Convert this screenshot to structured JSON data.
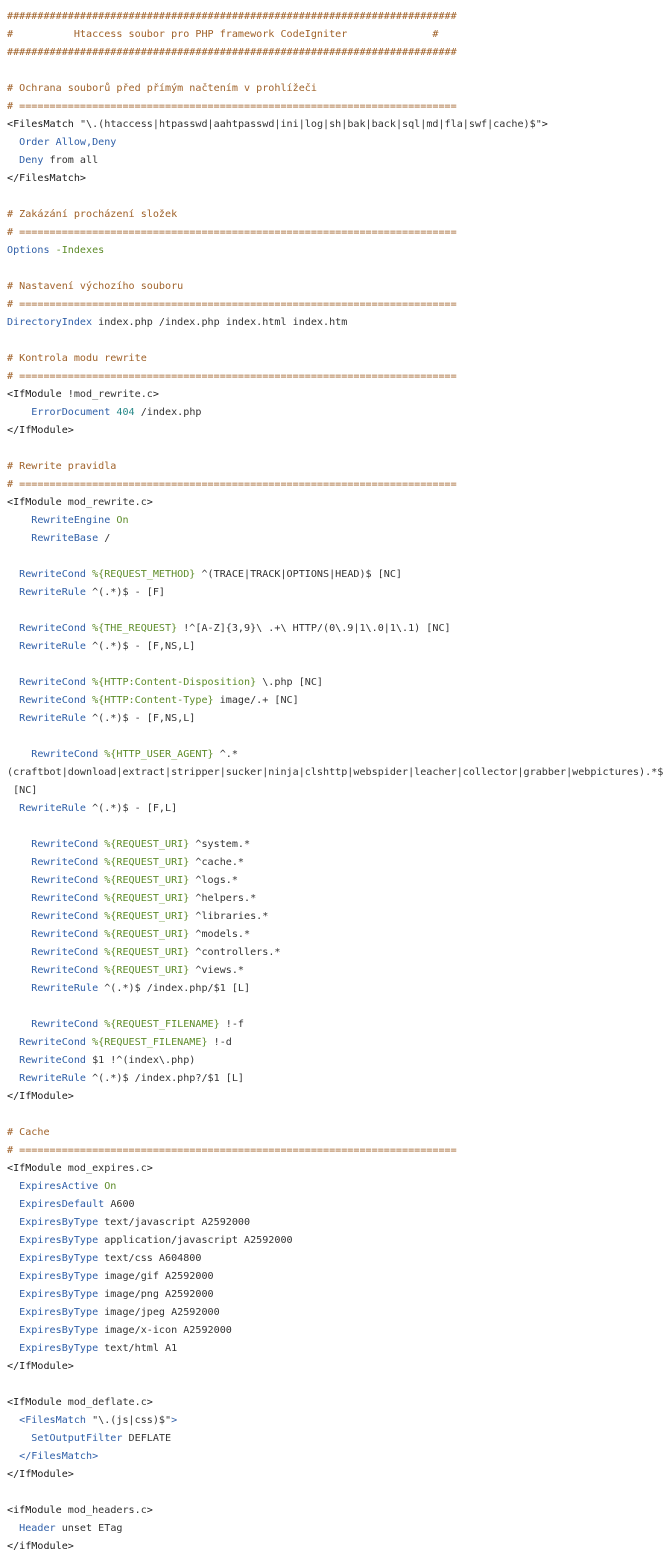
{
  "document": {
    "lines": [
      {
        "segments": [
          {
            "t": "##########################################################################",
            "c": "cm"
          }
        ]
      },
      {
        "segments": [
          {
            "t": "#          Htaccess soubor pro PHP framework CodeIgniter              #",
            "c": "cm"
          }
        ]
      },
      {
        "segments": [
          {
            "t": "##########################################################################",
            "c": "cm"
          }
        ]
      },
      {
        "segments": []
      },
      {
        "segments": [
          {
            "t": "# Ochrana souborů před přímým načtením v prohlížeči",
            "c": "cm"
          }
        ]
      },
      {
        "segments": [
          {
            "t": "# ========================================================================",
            "c": "cm"
          }
        ]
      },
      {
        "segments": [
          {
            "t": "<FilesMatch ",
            "c": "tg"
          },
          {
            "t": "\"\\.(htaccess|htpasswd|aahtpasswd|ini|log|sh|bak|back|sql|md|fla|swf|cache)$\"",
            "c": "st"
          },
          {
            "t": ">",
            "c": "tg"
          }
        ]
      },
      {
        "segments": [
          {
            "t": "  Order Allow,Deny",
            "c": "kw"
          }
        ]
      },
      {
        "segments": [
          {
            "t": "  Deny ",
            "c": "kw"
          },
          {
            "t": "from all",
            "c": "st"
          }
        ]
      },
      {
        "segments": [
          {
            "t": "</FilesMatch>",
            "c": "tg"
          }
        ]
      },
      {
        "segments": []
      },
      {
        "segments": [
          {
            "t": "# Zakázání procházení složek",
            "c": "cm"
          }
        ]
      },
      {
        "segments": [
          {
            "t": "# ========================================================================",
            "c": "cm"
          }
        ]
      },
      {
        "segments": [
          {
            "t": "Options ",
            "c": "kw"
          },
          {
            "t": "-Indexes",
            "c": "fl"
          }
        ]
      },
      {
        "segments": []
      },
      {
        "segments": [
          {
            "t": "# Nastavení výchozího souboru",
            "c": "cm"
          }
        ]
      },
      {
        "segments": [
          {
            "t": "# ========================================================================",
            "c": "cm"
          }
        ]
      },
      {
        "segments": [
          {
            "t": "DirectoryIndex ",
            "c": "kw"
          },
          {
            "t": "index.php /index.php index.html index.htm",
            "c": "st"
          }
        ]
      },
      {
        "segments": []
      },
      {
        "segments": [
          {
            "t": "# Kontrola modu rewrite",
            "c": "cm"
          }
        ]
      },
      {
        "segments": [
          {
            "t": "# ========================================================================",
            "c": "cm"
          }
        ]
      },
      {
        "segments": [
          {
            "t": "<IfModule ",
            "c": "tg"
          },
          {
            "t": "!mod_rewrite.c",
            "c": "st"
          },
          {
            "t": ">",
            "c": "tg"
          }
        ]
      },
      {
        "segments": [
          {
            "t": "    ErrorDocument ",
            "c": "kw"
          },
          {
            "t": "404",
            "c": "nm"
          },
          {
            "t": " /index.php",
            "c": "st"
          }
        ]
      },
      {
        "segments": [
          {
            "t": "</IfModule>",
            "c": "tg"
          }
        ]
      },
      {
        "segments": []
      },
      {
        "segments": [
          {
            "t": "# Rewrite pravidla",
            "c": "cm"
          }
        ]
      },
      {
        "segments": [
          {
            "t": "# ========================================================================",
            "c": "cm"
          }
        ]
      },
      {
        "segments": [
          {
            "t": "<IfModule ",
            "c": "tg"
          },
          {
            "t": "mod_rewrite.c",
            "c": "st"
          },
          {
            "t": ">",
            "c": "tg"
          }
        ]
      },
      {
        "segments": [
          {
            "t": "    RewriteEngine ",
            "c": "kw"
          },
          {
            "t": "On",
            "c": "fl"
          }
        ]
      },
      {
        "segments": [
          {
            "t": "    RewriteBase ",
            "c": "kw"
          },
          {
            "t": "/",
            "c": "st"
          }
        ]
      },
      {
        "segments": []
      },
      {
        "segments": [
          {
            "t": "  RewriteCond ",
            "c": "kw"
          },
          {
            "t": "%{REQUEST_METHOD}",
            "c": "fl"
          },
          {
            "t": " ^(TRACE|TRACK|OPTIONS|HEAD)$ [NC]",
            "c": "st"
          }
        ]
      },
      {
        "segments": [
          {
            "t": "  RewriteRule ",
            "c": "kw"
          },
          {
            "t": "^(.*)$ - [F]",
            "c": "st"
          }
        ]
      },
      {
        "segments": []
      },
      {
        "segments": [
          {
            "t": "  RewriteCond ",
            "c": "kw"
          },
          {
            "t": "%{THE_REQUEST}",
            "c": "fl"
          },
          {
            "t": " !^[A-Z]{3,9}\\ .+\\ HTTP/(0\\.9|1\\.0|1\\.1) [NC]",
            "c": "st"
          }
        ]
      },
      {
        "segments": [
          {
            "t": "  RewriteRule ",
            "c": "kw"
          },
          {
            "t": "^(.*)$ - [F,NS,L]",
            "c": "st"
          }
        ]
      },
      {
        "segments": []
      },
      {
        "segments": [
          {
            "t": "  RewriteCond ",
            "c": "kw"
          },
          {
            "t": "%{HTTP:Content-Disposition}",
            "c": "fl"
          },
          {
            "t": " \\.php [NC]",
            "c": "st"
          }
        ]
      },
      {
        "segments": [
          {
            "t": "  RewriteCond ",
            "c": "kw"
          },
          {
            "t": "%{HTTP:Content-Type}",
            "c": "fl"
          },
          {
            "t": " image/.+ [NC]",
            "c": "st"
          }
        ]
      },
      {
        "segments": [
          {
            "t": "  RewriteRule ",
            "c": "kw"
          },
          {
            "t": "^(.*)$ - [F,NS,L]",
            "c": "st"
          }
        ]
      },
      {
        "segments": []
      },
      {
        "segments": [
          {
            "t": "    RewriteCond ",
            "c": "kw"
          },
          {
            "t": "%{HTTP_USER_AGENT}",
            "c": "fl"
          },
          {
            "t": " ^.*",
            "c": "st"
          }
        ]
      },
      {
        "segments": [
          {
            "t": "(craftbot|download|extract|stripper|sucker|ninja|clshttp|webspider|leacher|collector|grabber|webpictures).*$",
            "c": "st"
          }
        ]
      },
      {
        "segments": [
          {
            "t": " [NC]",
            "c": "st"
          }
        ]
      },
      {
        "segments": [
          {
            "t": "  RewriteRule ",
            "c": "kw"
          },
          {
            "t": "^(.*)$ - [F,L]",
            "c": "st"
          }
        ]
      },
      {
        "segments": []
      },
      {
        "segments": [
          {
            "t": "    RewriteCond ",
            "c": "kw"
          },
          {
            "t": "%{REQUEST_URI}",
            "c": "fl"
          },
          {
            "t": " ^system.*",
            "c": "st"
          }
        ]
      },
      {
        "segments": [
          {
            "t": "    RewriteCond ",
            "c": "kw"
          },
          {
            "t": "%{REQUEST_URI}",
            "c": "fl"
          },
          {
            "t": " ^cache.*",
            "c": "st"
          }
        ]
      },
      {
        "segments": [
          {
            "t": "    RewriteCond ",
            "c": "kw"
          },
          {
            "t": "%{REQUEST_URI}",
            "c": "fl"
          },
          {
            "t": " ^logs.*",
            "c": "st"
          }
        ]
      },
      {
        "segments": [
          {
            "t": "    RewriteCond ",
            "c": "kw"
          },
          {
            "t": "%{REQUEST_URI}",
            "c": "fl"
          },
          {
            "t": " ^helpers.*",
            "c": "st"
          }
        ]
      },
      {
        "segments": [
          {
            "t": "    RewriteCond ",
            "c": "kw"
          },
          {
            "t": "%{REQUEST_URI}",
            "c": "fl"
          },
          {
            "t": " ^libraries.*",
            "c": "st"
          }
        ]
      },
      {
        "segments": [
          {
            "t": "    RewriteCond ",
            "c": "kw"
          },
          {
            "t": "%{REQUEST_URI}",
            "c": "fl"
          },
          {
            "t": " ^models.*",
            "c": "st"
          }
        ]
      },
      {
        "segments": [
          {
            "t": "    RewriteCond ",
            "c": "kw"
          },
          {
            "t": "%{REQUEST_URI}",
            "c": "fl"
          },
          {
            "t": " ^controllers.*",
            "c": "st"
          }
        ]
      },
      {
        "segments": [
          {
            "t": "    RewriteCond ",
            "c": "kw"
          },
          {
            "t": "%{REQUEST_URI}",
            "c": "fl"
          },
          {
            "t": " ^views.*",
            "c": "st"
          }
        ]
      },
      {
        "segments": [
          {
            "t": "    RewriteRule ",
            "c": "kw"
          },
          {
            "t": "^(.*)$ /index.php/$1 [L]",
            "c": "st"
          }
        ]
      },
      {
        "segments": []
      },
      {
        "segments": [
          {
            "t": "    RewriteCond ",
            "c": "kw"
          },
          {
            "t": "%{REQUEST_FILENAME}",
            "c": "fl"
          },
          {
            "t": " !-f",
            "c": "st"
          }
        ]
      },
      {
        "segments": [
          {
            "t": "  RewriteCond ",
            "c": "kw"
          },
          {
            "t": "%{REQUEST_FILENAME}",
            "c": "fl"
          },
          {
            "t": " !-d",
            "c": "st"
          }
        ]
      },
      {
        "segments": [
          {
            "t": "  RewriteCond ",
            "c": "kw"
          },
          {
            "t": "$1 !^(index\\.php)",
            "c": "st"
          }
        ]
      },
      {
        "segments": [
          {
            "t": "  RewriteRule ",
            "c": "kw"
          },
          {
            "t": "^(.*)$ /index.php?/$1 [L]",
            "c": "st"
          }
        ]
      },
      {
        "segments": [
          {
            "t": "</IfModule>",
            "c": "tg"
          }
        ]
      },
      {
        "segments": []
      },
      {
        "segments": [
          {
            "t": "# Cache",
            "c": "cm"
          }
        ]
      },
      {
        "segments": [
          {
            "t": "# ========================================================================",
            "c": "cm"
          }
        ]
      },
      {
        "segments": [
          {
            "t": "<IfModule ",
            "c": "tg"
          },
          {
            "t": "mod_expires.c",
            "c": "st"
          },
          {
            "t": ">",
            "c": "tg"
          }
        ]
      },
      {
        "segments": [
          {
            "t": "  ExpiresActive ",
            "c": "kw"
          },
          {
            "t": "On",
            "c": "fl"
          }
        ]
      },
      {
        "segments": [
          {
            "t": "  ExpiresDefault ",
            "c": "kw"
          },
          {
            "t": "A600",
            "c": "st"
          }
        ]
      },
      {
        "segments": [
          {
            "t": "  ExpiresByType ",
            "c": "kw"
          },
          {
            "t": "text/javascript A2592000",
            "c": "st"
          }
        ]
      },
      {
        "segments": [
          {
            "t": "  ExpiresByType ",
            "c": "kw"
          },
          {
            "t": "application/javascript A2592000",
            "c": "st"
          }
        ]
      },
      {
        "segments": [
          {
            "t": "  ExpiresByType ",
            "c": "kw"
          },
          {
            "t": "text/css A604800",
            "c": "st"
          }
        ]
      },
      {
        "segments": [
          {
            "t": "  ExpiresByType ",
            "c": "kw"
          },
          {
            "t": "image/gif A2592000",
            "c": "st"
          }
        ]
      },
      {
        "segments": [
          {
            "t": "  ExpiresByType ",
            "c": "kw"
          },
          {
            "t": "image/png A2592000",
            "c": "st"
          }
        ]
      },
      {
        "segments": [
          {
            "t": "  ExpiresByType ",
            "c": "kw"
          },
          {
            "t": "image/jpeg A2592000",
            "c": "st"
          }
        ]
      },
      {
        "segments": [
          {
            "t": "  ExpiresByType ",
            "c": "kw"
          },
          {
            "t": "image/x-icon A2592000",
            "c": "st"
          }
        ]
      },
      {
        "segments": [
          {
            "t": "  ExpiresByType ",
            "c": "kw"
          },
          {
            "t": "text/html A1",
            "c": "st"
          }
        ]
      },
      {
        "segments": [
          {
            "t": "</IfModule>",
            "c": "tg"
          }
        ]
      },
      {
        "segments": []
      },
      {
        "segments": [
          {
            "t": "<IfModule ",
            "c": "tg"
          },
          {
            "t": "mod_deflate.c",
            "c": "st"
          },
          {
            "t": ">",
            "c": "tg"
          }
        ]
      },
      {
        "segments": [
          {
            "t": "  <FilesMatch ",
            "c": "kw"
          },
          {
            "t": "\"\\.(js|css)$\"",
            "c": "st"
          },
          {
            "t": ">",
            "c": "kw"
          }
        ]
      },
      {
        "segments": [
          {
            "t": "    SetOutputFilter ",
            "c": "kw"
          },
          {
            "t": "DEFLATE",
            "c": "st"
          }
        ]
      },
      {
        "segments": [
          {
            "t": "  </FilesMatch>",
            "c": "kw"
          }
        ]
      },
      {
        "segments": [
          {
            "t": "</IfModule>",
            "c": "tg"
          }
        ]
      },
      {
        "segments": []
      },
      {
        "segments": [
          {
            "t": "<ifModule ",
            "c": "tg"
          },
          {
            "t": "mod_headers.c",
            "c": "st"
          },
          {
            "t": ">",
            "c": "tg"
          }
        ]
      },
      {
        "segments": [
          {
            "t": "  Header ",
            "c": "kw"
          },
          {
            "t": "unset ETag",
            "c": "st"
          }
        ]
      },
      {
        "segments": [
          {
            "t": "</ifModule>",
            "c": "tg"
          }
        ]
      }
    ]
  }
}
